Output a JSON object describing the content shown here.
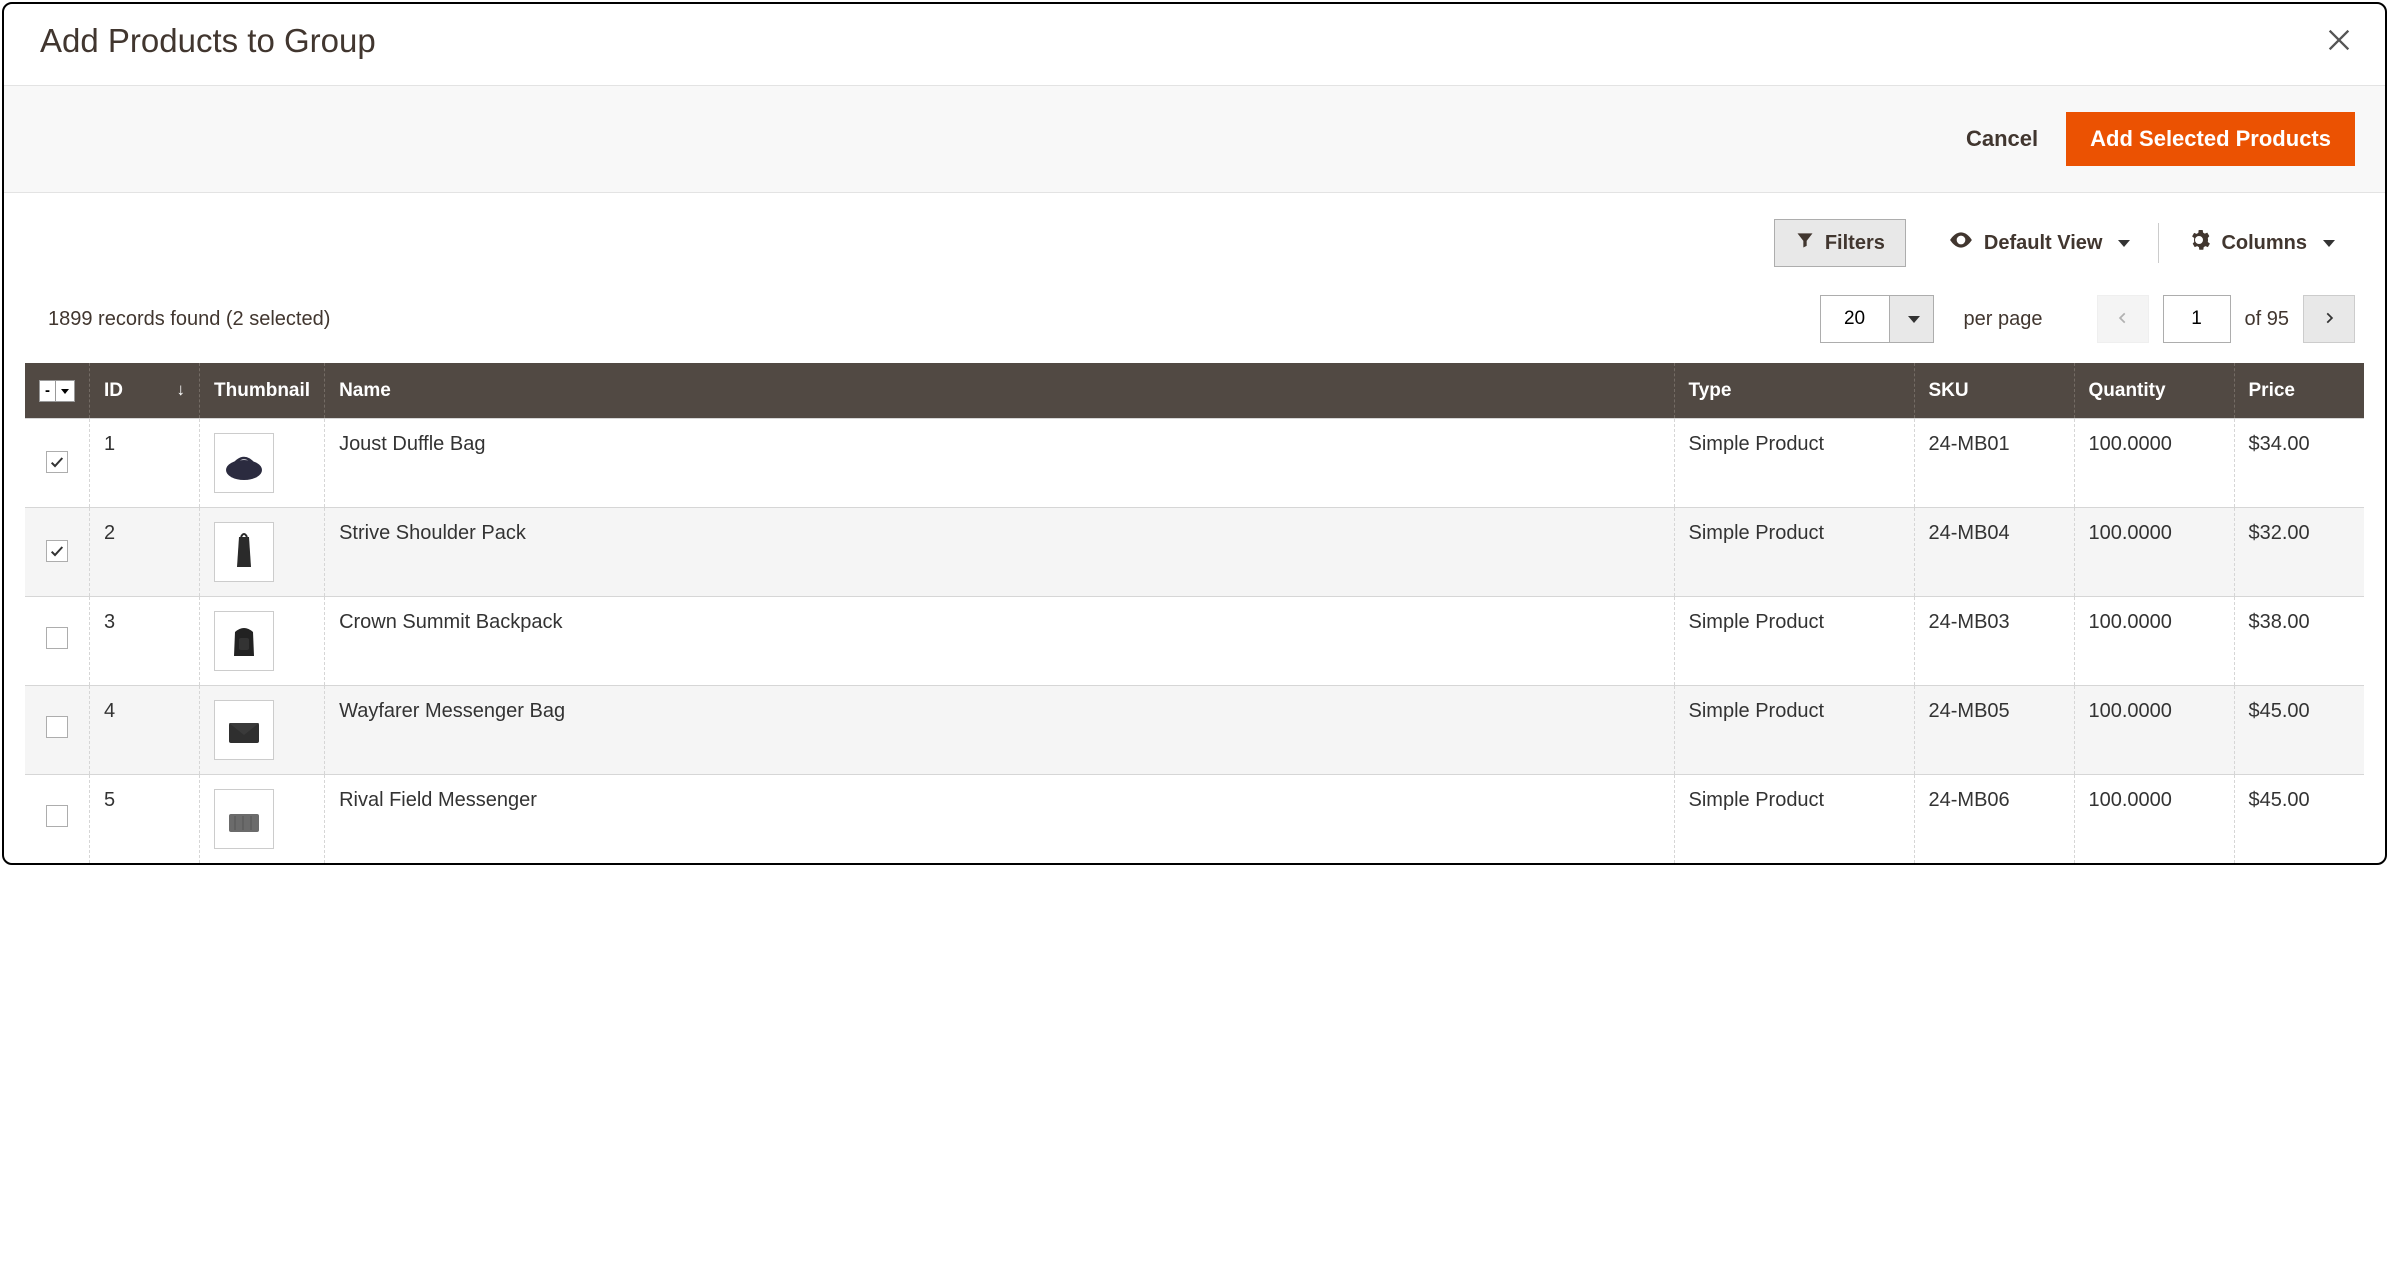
{
  "header": {
    "title": "Add Products to Group"
  },
  "actions": {
    "cancel": "Cancel",
    "primary": "Add Selected Products"
  },
  "toolbar": {
    "filters": "Filters",
    "default_view": "Default View",
    "columns": "Columns"
  },
  "records": {
    "text": "1899 records found (2 selected)"
  },
  "pagination": {
    "per_page": "20",
    "per_page_label": "per page",
    "current": "1",
    "of_label": "of",
    "total_pages": "95"
  },
  "columns": {
    "id": "ID",
    "thumbnail": "Thumbnail",
    "name": "Name",
    "type": "Type",
    "sku": "SKU",
    "quantity": "Quantity",
    "price": "Price"
  },
  "rows": [
    {
      "checked": true,
      "id": "1",
      "name": "Joust Duffle Bag",
      "type": "Simple Product",
      "sku": "24-MB01",
      "qty": "100.0000",
      "price": "$34.00",
      "thumb": "duffle"
    },
    {
      "checked": true,
      "id": "2",
      "name": "Strive Shoulder Pack",
      "type": "Simple Product",
      "sku": "24-MB04",
      "qty": "100.0000",
      "price": "$32.00",
      "thumb": "shoulder"
    },
    {
      "checked": false,
      "id": "3",
      "name": "Crown Summit Backpack",
      "type": "Simple Product",
      "sku": "24-MB03",
      "qty": "100.0000",
      "price": "$38.00",
      "thumb": "backpack"
    },
    {
      "checked": false,
      "id": "4",
      "name": "Wayfarer Messenger Bag",
      "type": "Simple Product",
      "sku": "24-MB05",
      "qty": "100.0000",
      "price": "$45.00",
      "thumb": "messenger"
    },
    {
      "checked": false,
      "id": "5",
      "name": "Rival Field Messenger",
      "type": "Simple Product",
      "sku": "24-MB06",
      "qty": "100.0000",
      "price": "$45.00",
      "thumb": "field"
    }
  ]
}
